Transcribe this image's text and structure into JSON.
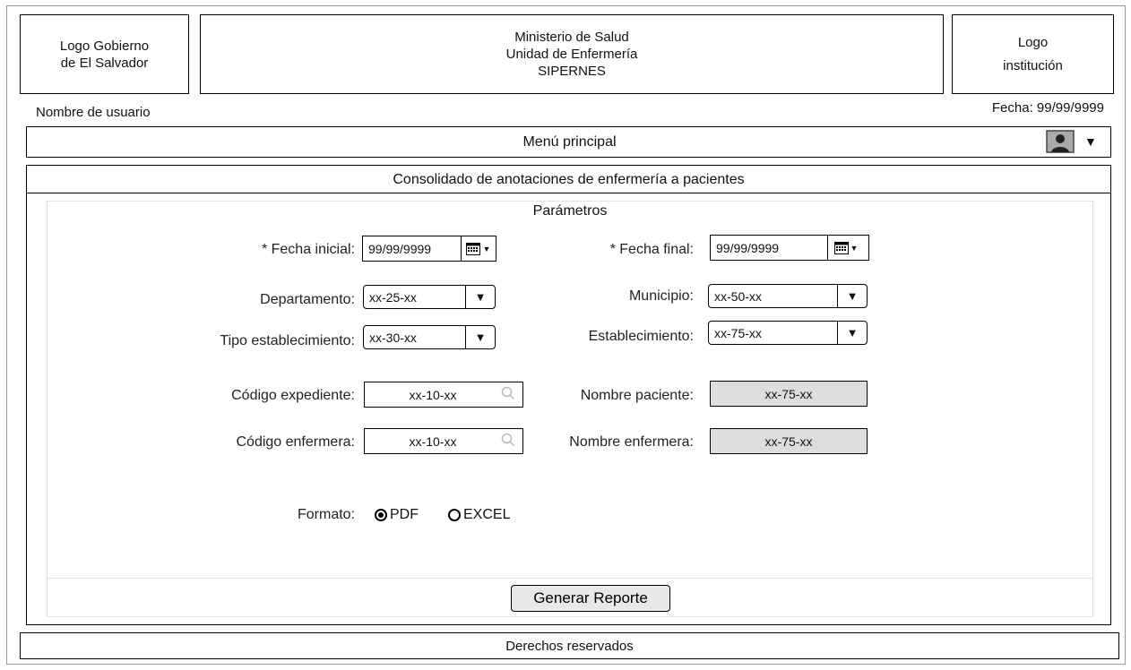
{
  "header": {
    "logo_left_line1": "Logo Gobierno",
    "logo_left_line2": "de El Salvador",
    "title_line1": "Ministerio de Salud",
    "title_line2": "Unidad de Enfermería",
    "title_line3": "SIPERNES",
    "logo_right_line1": "Logo",
    "logo_right_line2": "institución"
  },
  "user": {
    "name": "Nombre de usuario",
    "date": "Fecha: 99/99/9999"
  },
  "menu": {
    "label": "Menú principal",
    "user_icon": "user-avatar-icon",
    "dropdown_icon": "triangle-down-icon"
  },
  "panel": {
    "title": "Consolidado de anotaciones de enfermería a pacientes",
    "params_title": "Parámetros"
  },
  "form": {
    "fecha_inicial_label": "* Fecha inicial:",
    "fecha_inicial_value": "99/99/9999",
    "fecha_final_label": "* Fecha final:",
    "fecha_final_value": "99/99/9999",
    "departamento_label": "Departamento:",
    "departamento_value": "xx-25-xx",
    "municipio_label": "Municipio:",
    "municipio_value": "xx-50-xx",
    "tipo_label": "Tipo establecimiento:",
    "tipo_value": "xx-30-xx",
    "establecimiento_label": "Establecimiento:",
    "establecimiento_value": "xx-75-xx",
    "codigo_expediente_label": "Código expediente:",
    "codigo_expediente_value": "xx-10-xx",
    "nombre_paciente_label": "Nombre paciente:",
    "nombre_paciente_value": "xx-75-xx",
    "codigo_enfermera_label": "Código enfermera:",
    "codigo_enfermera_value": "xx-10-xx",
    "nombre_enfermera_label": "Nombre enfermera:",
    "nombre_enfermera_value": "xx-75-xx",
    "formato_label": "Formato:",
    "formato_options": [
      "PDF",
      "EXCEL"
    ],
    "formato_selected": "PDF"
  },
  "actions": {
    "generate_label": "Generar Reporte"
  },
  "footer": {
    "text": "Derechos reservados"
  }
}
